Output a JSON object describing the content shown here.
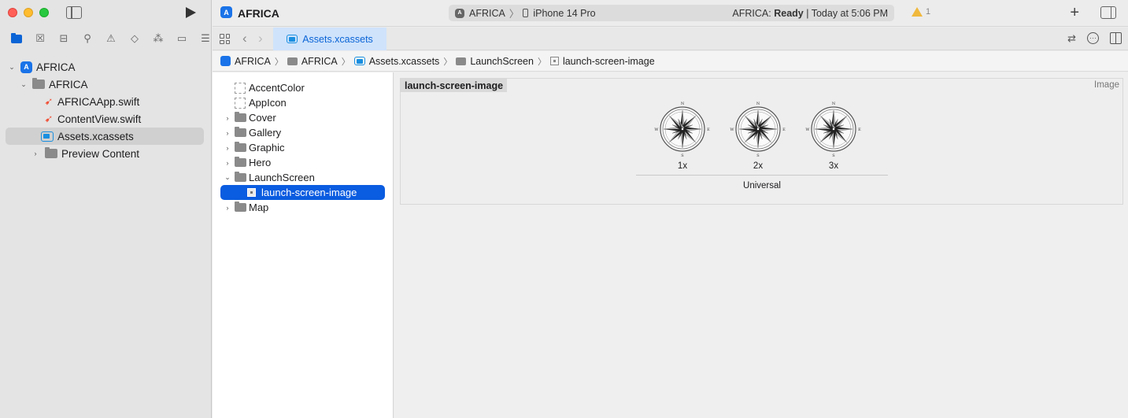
{
  "window": {
    "project_name": "AFRICA"
  },
  "toolbar": {
    "scheme_app": "AFRICA",
    "device": "iPhone 14 Pro",
    "status_prefix": "AFRICA: ",
    "status_state": "Ready",
    "status_time": " | Today at 5:06 PM",
    "warning_count": "1"
  },
  "navigator": {
    "items": [
      {
        "label": "AFRICA",
        "icon": "app-icon",
        "expanded": true
      },
      {
        "label": "AFRICA",
        "icon": "folder-icon",
        "expanded": true
      },
      {
        "label": "AFRICAApp.swift",
        "icon": "swift-icon"
      },
      {
        "label": "ContentView.swift",
        "icon": "swift-icon"
      },
      {
        "label": "Assets.xcassets",
        "icon": "xcassets-icon",
        "selected": true
      },
      {
        "label": "Preview Content",
        "icon": "folder-icon",
        "expanded": false
      }
    ]
  },
  "editor_tab": {
    "label": "Assets.xcassets"
  },
  "breadcrumb": [
    "AFRICA",
    "AFRICA",
    "Assets.xcassets",
    "LaunchScreen",
    "launch-screen-image"
  ],
  "asset_list": {
    "items": [
      {
        "label": "AccentColor",
        "kind": "color"
      },
      {
        "label": "AppIcon",
        "kind": "appicon"
      },
      {
        "label": "Cover",
        "kind": "folder"
      },
      {
        "label": "Gallery",
        "kind": "folder"
      },
      {
        "label": "Graphic",
        "kind": "folder"
      },
      {
        "label": "Hero",
        "kind": "folder"
      },
      {
        "label": "LaunchScreen",
        "kind": "folder",
        "expanded": true
      },
      {
        "label": "launch-screen-image",
        "kind": "imageset",
        "selected": true
      },
      {
        "label": "Map",
        "kind": "folder"
      }
    ]
  },
  "detail": {
    "set_name": "launch-screen-image",
    "set_type": "Image",
    "slots": [
      "1x",
      "2x",
      "3x"
    ],
    "compass_letters": {
      "n": "N",
      "s": "S",
      "e": "E",
      "w": "W"
    },
    "idiom": "Universal"
  },
  "colors": {
    "accent": "#0a5ce0",
    "tab_bg": "#cfe3fb",
    "sidebar_bg": "#e4e4e4"
  }
}
